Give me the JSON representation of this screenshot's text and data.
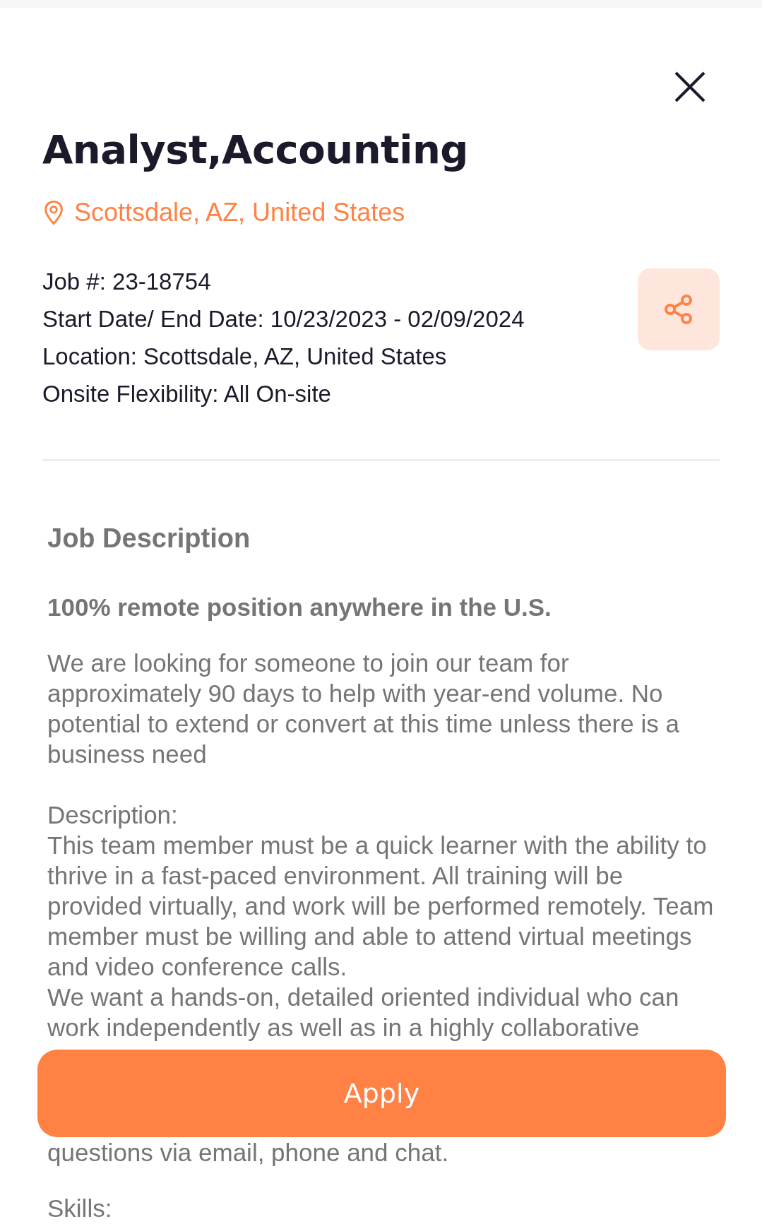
{
  "title": "Analyst,Accounting",
  "location": "Scottsdale, AZ, United States",
  "details": [
    "Job #: 23-18754",
    "Start Date/ End Date: 10/23/2023 - 02/09/2024",
    "Location: Scottsdale, AZ, United States",
    "Onsite Flexibility: All On-site"
  ],
  "description": {
    "heading": "Job Description",
    "paragraphs": [
      {
        "kind": "bold",
        "text": "100% remote position anywhere in the U.S."
      },
      {
        "kind": "plain",
        "text": "We are looking for someone to join our team for approximately 90 days to help with year-end volume. No potential to extend or convert at this time unless there is a business need"
      },
      {
        "kind": "label",
        "text": "Description:"
      },
      {
        "kind": "tight",
        "text": "This team member must be a quick learner with the ability to thrive in a fast-paced environment. All training will be provided virtually, and work will be performed remotely. Team member must be willing and able to attend virtual meetings and video conference calls."
      },
      {
        "kind": "tight",
        "text": "We want a hands-on, detailed oriented individual who can work independently as well as in a highly collaborative"
      },
      {
        "kind": "after",
        "text": "questions via email, phone and chat."
      },
      {
        "kind": "plain",
        "text": "Skills:"
      }
    ]
  },
  "apply_button": "Apply"
}
